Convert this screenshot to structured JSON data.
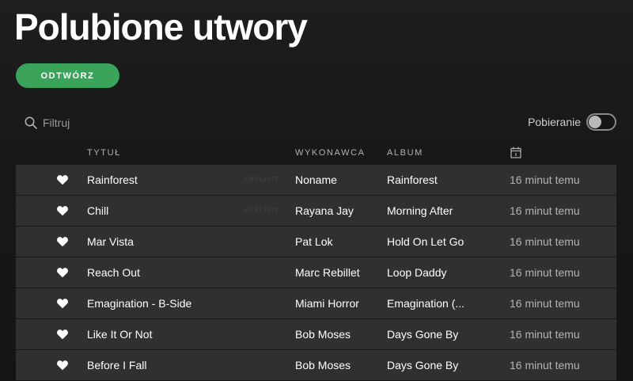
{
  "header": {
    "title": "Polubione utwory",
    "play_label": "ODTWÓRZ"
  },
  "filter": {
    "placeholder": "Filtruj",
    "icon": "search-icon"
  },
  "download": {
    "label": "Pobieranie",
    "enabled": false
  },
  "columns": {
    "title": "TYTUŁ",
    "artist": "WYKONAWCA",
    "album": "ALBUM",
    "date_icon": "calendar-icon"
  },
  "colors": {
    "accent": "#3aa45b",
    "row_bg": "#303030",
    "background": "#151515"
  },
  "tracks": [
    {
      "title": "Rainforest",
      "explicit": "EXPLICIT",
      "artist": "Noname",
      "album": "Rainforest",
      "added": "16 minut temu"
    },
    {
      "title": "Chill",
      "explicit": "EXPLICIT",
      "artist": "Rayana Jay",
      "album": "Morning After",
      "added": "16 minut temu"
    },
    {
      "title": "Mar Vista",
      "explicit": "",
      "artist": "Pat Lok",
      "album": "Hold On Let Go",
      "added": "16 minut temu"
    },
    {
      "title": "Reach Out",
      "explicit": "",
      "artist": "Marc Rebillet",
      "album": "Loop Daddy",
      "added": "16 minut temu"
    },
    {
      "title": "Emagination - B-Side",
      "explicit": "",
      "artist": "Miami Horror",
      "album": "Emagination (...",
      "added": "16 minut temu"
    },
    {
      "title": "Like It Or Not",
      "explicit": "",
      "artist": "Bob Moses",
      "album": "Days Gone By",
      "added": "16 minut temu"
    },
    {
      "title": "Before I Fall",
      "explicit": "",
      "artist": "Bob Moses",
      "album": "Days Gone By",
      "added": "16 minut temu"
    }
  ]
}
